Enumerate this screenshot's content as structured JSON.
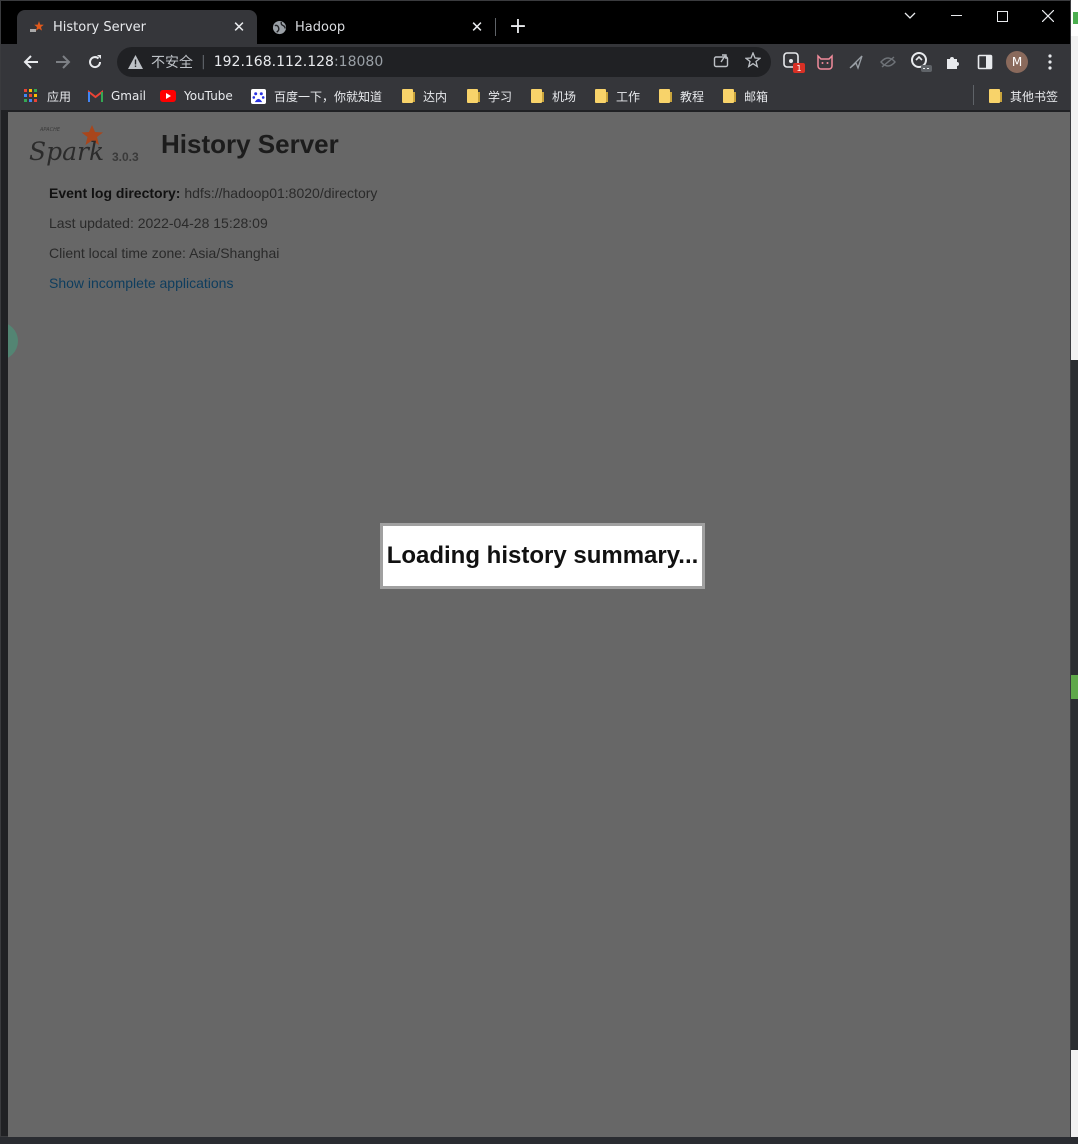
{
  "browser": {
    "tabs": [
      {
        "title": "History Server",
        "active": true
      },
      {
        "title": "Hadoop",
        "active": false
      }
    ],
    "address": {
      "security_label": "不安全",
      "host": "192.168.112.128",
      "port": ":18080"
    },
    "profile_initial": "M",
    "extension_badge": "1",
    "bookmarks": [
      {
        "label": "应用",
        "icon": "apps-grid-icon"
      },
      {
        "label": "Gmail",
        "icon": "gmail-icon"
      },
      {
        "label": "YouTube",
        "icon": "youtube-icon"
      },
      {
        "label": "百度一下，你就知道",
        "icon": "baidu-icon"
      },
      {
        "label": "达内",
        "icon": "folder-icon"
      },
      {
        "label": "学习",
        "icon": "folder-icon"
      },
      {
        "label": "机场",
        "icon": "folder-icon"
      },
      {
        "label": "工作",
        "icon": "folder-icon"
      },
      {
        "label": "教程",
        "icon": "folder-icon"
      },
      {
        "label": "邮箱",
        "icon": "folder-icon"
      }
    ],
    "other_bookmarks": "其他书签"
  },
  "page": {
    "logo_text": "Spark",
    "logo_apache": "APACHE",
    "version": "3.0.3",
    "title": "History Server",
    "event_log_label": "Event log directory:",
    "event_log_value": "hdfs://hadoop01:8020/directory",
    "last_updated": "Last updated: 2022-04-28 15:28:09",
    "time_zone": "Client local time zone: Asia/Shanghai",
    "show_incomplete": "Show incomplete applications",
    "loading": "Loading history summary..."
  },
  "colors": {
    "overlay": "#676767",
    "link": "#0e3d5e",
    "spark_orange": "#e25a1c"
  }
}
